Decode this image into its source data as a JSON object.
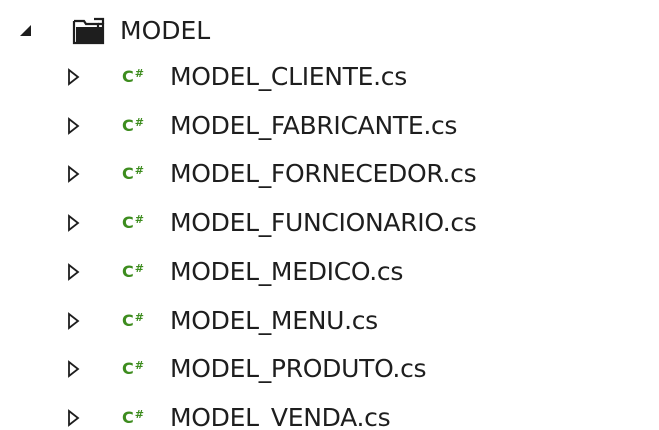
{
  "tree": {
    "folder": {
      "label": "MODEL",
      "icon": "folder-open-icon",
      "expanded": true
    },
    "files": [
      {
        "label": "MODEL_CLIENTE.cs",
        "icon_text": "C#"
      },
      {
        "label": "MODEL_FABRICANTE.cs",
        "icon_text": "C#"
      },
      {
        "label": "MODEL_FORNECEDOR.cs",
        "icon_text": "C#"
      },
      {
        "label": "MODEL_FUNCIONARIO.cs",
        "icon_text": "C#"
      },
      {
        "label": "MODEL_MEDICO.cs",
        "icon_text": "C#"
      },
      {
        "label": "MODEL_MENU.cs",
        "icon_text": "C#"
      },
      {
        "label": "MODEL_PRODUTO.cs",
        "icon_text": "C#"
      },
      {
        "label": "MODEL_VENDA.cs",
        "icon_text": "C#"
      }
    ],
    "colors": {
      "text": "#1e1e1e",
      "csharp_icon": "#3d8c1e",
      "expander": "#1e1e1e"
    }
  }
}
